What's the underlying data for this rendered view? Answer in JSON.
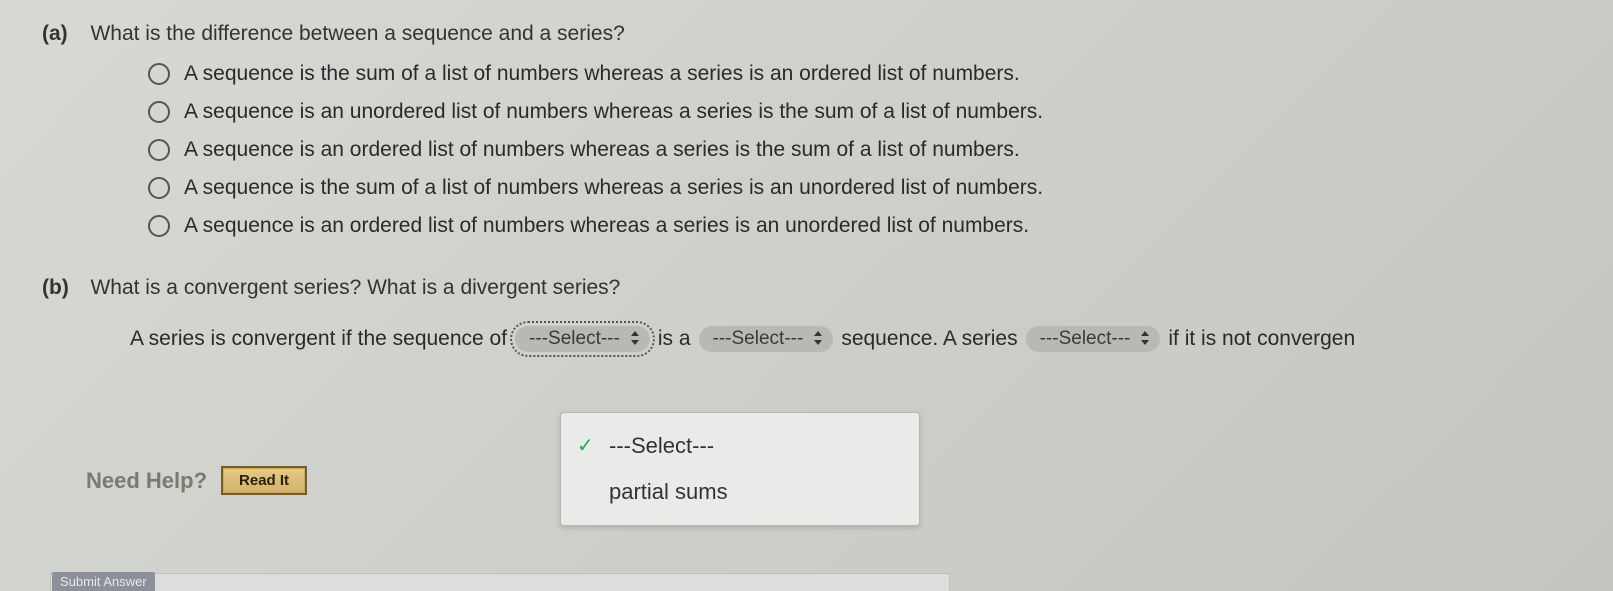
{
  "partA": {
    "label": "(a)",
    "question": "What is the difference between a sequence and a series?",
    "options": [
      "A sequence is the sum of a list of numbers whereas a series is an ordered list of numbers.",
      "A sequence is an unordered list of numbers whereas a series is the sum of a list of numbers.",
      "A sequence is an ordered list of numbers whereas a series is the sum of a list of numbers.",
      "A sequence is the sum of a list of numbers whereas a series is an unordered list of numbers.",
      "A sequence is an ordered list of numbers whereas a series is an unordered list of numbers."
    ]
  },
  "partB": {
    "label": "(b)",
    "question": "What is a convergent series? What is a divergent series?",
    "sentence": {
      "s1": "A series is convergent if the sequence of",
      "sel1": "---Select---",
      "s2": "is a",
      "sel2": "---Select---",
      "s3": "sequence. A series",
      "sel3": "---Select---",
      "s4": "if it is not convergen"
    }
  },
  "dropdown": {
    "placeholder": "---Select---",
    "option1": "partial sums"
  },
  "help": {
    "label": "Need Help?",
    "readIt": "Read It"
  },
  "submit": {
    "label": "Submit Answer"
  }
}
